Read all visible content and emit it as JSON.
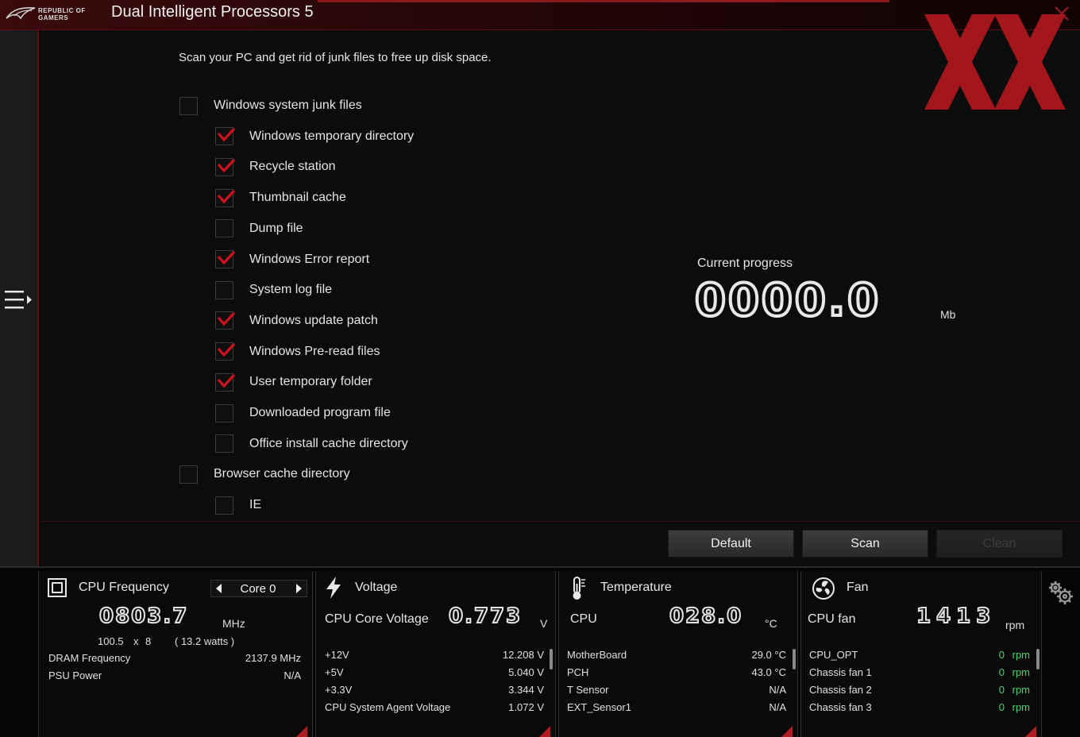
{
  "app": {
    "logo_text": "REPUBLIC OF\nGAMERS",
    "title": "Dual Intelligent Processors 5"
  },
  "main": {
    "description": "Scan your PC and get rid of junk files to free up disk space.",
    "items": [
      {
        "label": "Windows system junk files",
        "checked": false
      },
      {
        "label": "Windows temporary directory",
        "checked": true
      },
      {
        "label": "Recycle station",
        "checked": true
      },
      {
        "label": "Thumbnail cache",
        "checked": true
      },
      {
        "label": "Dump file",
        "checked": false
      },
      {
        "label": "Windows Error report",
        "checked": true
      },
      {
        "label": "System log file",
        "checked": false
      },
      {
        "label": "Windows update patch",
        "checked": true
      },
      {
        "label": "Windows Pre-read files",
        "checked": true
      },
      {
        "label": "User temporary folder",
        "checked": true
      },
      {
        "label": "Downloaded program file",
        "checked": false
      },
      {
        "label": "Office install cache directory",
        "checked": false
      },
      {
        "label": "Browser cache directory",
        "checked": false
      },
      {
        "label": "IE",
        "checked": false
      }
    ],
    "progress_label": "Current progress",
    "progress_value": "0000.0",
    "progress_unit": "Mb",
    "buttons": {
      "default": "Default",
      "scan": "Scan",
      "clean": "Clean"
    }
  },
  "cpu": {
    "title": "CPU Frequency",
    "core_label": "Core 0",
    "freq": "0803.7",
    "freq_unit": "MHz",
    "bclk": "100.5",
    "x": "x",
    "ratio": "8",
    "watts": "( 13.2 watts )",
    "rows": [
      {
        "label": "DRAM Frequency",
        "value": "2137.9  MHz"
      },
      {
        "label": "PSU Power",
        "value": "N/A"
      }
    ]
  },
  "voltage": {
    "title": "Voltage",
    "main_label": "CPU Core Voltage",
    "main_value": "0.773",
    "main_unit": "V",
    "rows": [
      {
        "label": "+12V",
        "value": "12.208  V"
      },
      {
        "label": "+5V",
        "value": "5.040  V"
      },
      {
        "label": "+3.3V",
        "value": "3.344  V"
      },
      {
        "label": "CPU System Agent Voltage",
        "value": "1.072  V"
      }
    ]
  },
  "temperature": {
    "title": "Temperature",
    "main_label": "CPU",
    "main_value": "028.0",
    "main_unit": "°C",
    "rows": [
      {
        "label": "MotherBoard",
        "value": "29.0 °C"
      },
      {
        "label": "PCH",
        "value": "43.0 °C"
      },
      {
        "label": "T Sensor",
        "value": "N/A"
      },
      {
        "label": "EXT_Sensor1",
        "value": "N/A"
      }
    ]
  },
  "fan": {
    "title": "Fan",
    "main_label": "CPU fan",
    "main_value": "1413",
    "main_unit": "rpm",
    "rows": [
      {
        "label": "CPU_OPT",
        "value": "0",
        "unit": "rpm"
      },
      {
        "label": "Chassis fan 1",
        "value": "0",
        "unit": "rpm"
      },
      {
        "label": "Chassis fan 2",
        "value": "0",
        "unit": "rpm"
      },
      {
        "label": "Chassis fan 3",
        "value": "0",
        "unit": "rpm"
      }
    ]
  },
  "colors": {
    "accent": "#c8102e",
    "check": "#d0121f",
    "fan_zero": "#48d66a"
  },
  "icons": {
    "menu": "menu-expand-icon",
    "close": "close-icon",
    "settings": "gears-icon",
    "cpu": "cpu-chip-icon",
    "voltage": "lightning-icon",
    "temperature": "thermometer-icon",
    "fan": "fan-icon"
  }
}
